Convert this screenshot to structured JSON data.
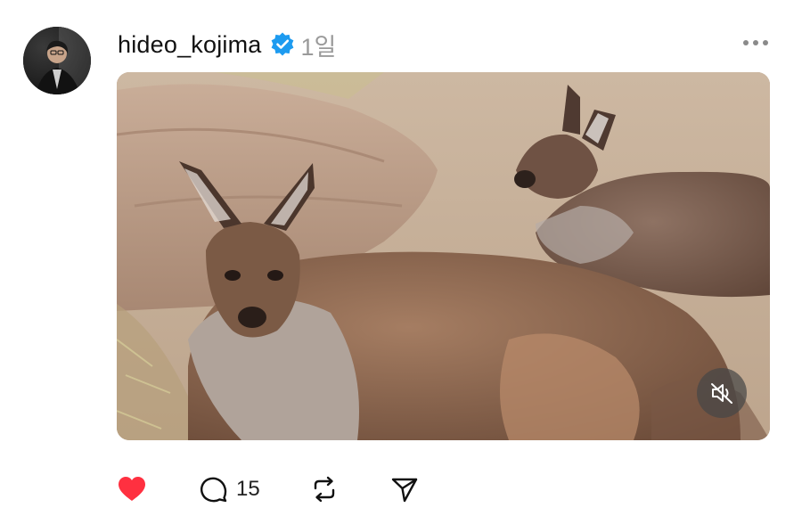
{
  "post": {
    "author": {
      "username": "hideo_kojima",
      "verified_icon": "verified-badge-icon",
      "verified_color": "#1d9bf0",
      "avatar_icon": "profile-avatar"
    },
    "timestamp": "1일",
    "more_icon": "more-options-icon",
    "media": {
      "type": "video",
      "mute_icon": "muted-speaker-icon",
      "muted": true
    },
    "actions": {
      "like": {
        "icon": "heart-filled-icon",
        "liked": true,
        "color": "#ff3040"
      },
      "reply": {
        "icon": "comment-bubble-icon",
        "count": "15"
      },
      "repost": {
        "icon": "repost-icon"
      },
      "share": {
        "icon": "send-paper-plane-icon"
      }
    }
  }
}
